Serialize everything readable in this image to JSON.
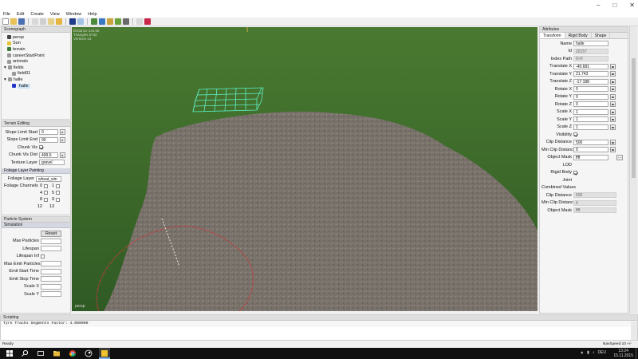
{
  "menu": [
    "File",
    "Edit",
    "Create",
    "View",
    "Window",
    "Help"
  ],
  "scenegraph": {
    "title": "Scenegraph",
    "items": [
      "persp",
      "Sun",
      "terrain",
      "careerStartPoint",
      "animals",
      "fields",
      "field01",
      "halle",
      "halle"
    ]
  },
  "terrain_editing": {
    "title": "Terrain Editing",
    "slope_start_label": "Slope Limit Start",
    "slope_start": "0",
    "slope_end_label": "Slope Limit End",
    "slope_end": "90",
    "chunk_vis_label": "Chunk Vis",
    "chunk_dist_label": "Chunk Vis Dist",
    "chunk_dist": "499.6",
    "texture_layer_label": "Texture Layer",
    "texture_layer": "gravel",
    "foliage_header": "Foliage Layer Painting",
    "foliage_layer_label": "Foliage Layer",
    "foliage_layer": "wheat_win",
    "foliage_channels_label": "Foliage Channels",
    "channels": [
      "0",
      "1",
      "4",
      "5",
      "8",
      "9",
      "12",
      "13"
    ]
  },
  "particle": {
    "title": "Particle System",
    "sub": "Simulation",
    "reset": "Reset",
    "rows": [
      "Max Particles",
      "Lifespan",
      "Lifespan Inf",
      "Max Emit Particles",
      "Emit Start Time",
      "Emit Stop Time",
      "Scale X",
      "Scale Y"
    ]
  },
  "viewport": {
    "stats": [
      "Distance 144.65",
      "Triangles 5742",
      "Vertices 14"
    ],
    "camera": "persp"
  },
  "attributes": {
    "title": "Attributes",
    "tabs": [
      "Transform",
      "Rigid Body",
      "Shape"
    ],
    "name_label": "Name",
    "name": "halle",
    "id_label": "Id",
    "id": "20157",
    "index_label": "Index Path",
    "index": "6>0",
    "tx_label": "Translate X",
    "tx": "-40.681",
    "ty_label": "Translate Y",
    "ty": "21.743",
    "tz_label": "Translate Z",
    "tz": "-17.188",
    "rx_label": "Rotate X",
    "rx": "0",
    "ry_label": "Rotate Y",
    "ry": "0",
    "rz_label": "Rotate Z",
    "rz": "0",
    "sx_label": "Scale X",
    "sx": "1",
    "sy_label": "Scale Y",
    "sy": "1",
    "sz_label": "Scale Z",
    "sz": "1",
    "vis_label": "Visibility",
    "clip_label": "Clip Distance",
    "clip": "500",
    "minclip_label": "Min Clip Distance",
    "minclip": "0",
    "mask_label": "Object Mask",
    "mask": "ffff",
    "mask_btn": "...",
    "lod_label": "LOD",
    "rigid_label": "Rigid Body",
    "joint_label": "Joint",
    "combined_label": "Combined Values",
    "c_clip_label": "Clip Distance",
    "c_clip": "500",
    "c_minclip_label": "Min Clip Distance",
    "c_minclip": "0",
    "c_mask_label": "Object Mask",
    "c_mask": "ffff"
  },
  "scripting": {
    "title": "Scripting",
    "line": "Tyre Tracks Segments Factor: 4.000000"
  },
  "status": {
    "left": "Ready",
    "right": "NavSpeed 10 +/-"
  },
  "taskbar": {
    "lang": "DEU",
    "time": "13:24",
    "date": "15.11.2015"
  },
  "colors": {
    "grass": "#3f6a2c",
    "gravel": "#7a746d",
    "wire": "#5ff0c6"
  }
}
